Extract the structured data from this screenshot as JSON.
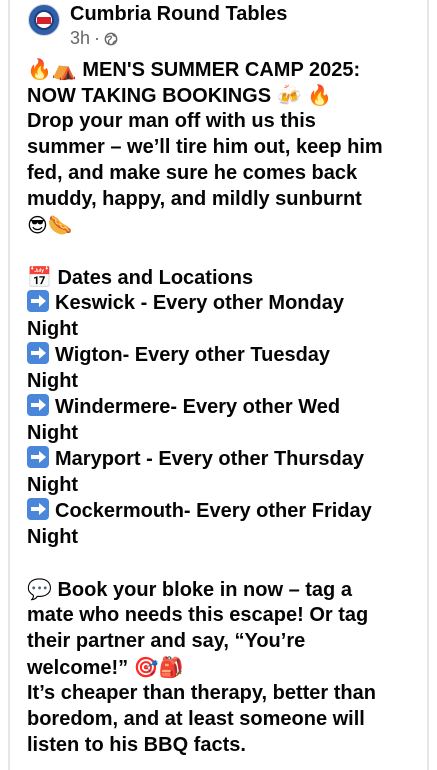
{
  "post": {
    "page_name": "Cumbria Round Tables",
    "time": "3h",
    "separator": "·",
    "line1": "MEN'S SUMMER CAMP 2025:",
    "line2": "NOW TAKING BOOKINGS",
    "line3": "Drop your man off with us this",
    "line4": "summer – we’ll tire him out, keep him",
    "line5": "fed, and make sure he comes back",
    "line6": "muddy, happy, and mildly sunburnt",
    "dates_heading": "Dates and Locations",
    "loc1a": "Keswick - Every other Monday",
    "loc1b": "Night",
    "loc2a": "Wigton- Every other Tuesday",
    "loc2b": "Night",
    "loc3a": "Windermere- Every other Wed",
    "loc3b": "Night",
    "loc4a": "Maryport - Every other Thursday",
    "loc4b": "Night",
    "loc5a": "Cockermouth- Every other Friday",
    "loc5b": "Night",
    "cta1": "Book your bloke in now – tag a",
    "cta2": "mate who needs this escape! Or tag",
    "cta3": "their partner and say, “You’re",
    "cta4": "welcome!”",
    "end1": "It’s cheaper than therapy, better than",
    "end2": "boredom, and at least someone will",
    "end3": "listen to his BBQ facts."
  },
  "emoji": {
    "fire": "🔥",
    "tent": "⛺",
    "beers": "🍻",
    "sunglasses": "😎",
    "hotdog": "🌭",
    "calendar": "📅",
    "speech": "💬",
    "target": "🎯",
    "backpack": "🎒"
  },
  "icons": {
    "globe": "globe-icon",
    "arrow": "right-arrow-icon"
  },
  "colors": {
    "text": "#050505",
    "meta": "#65676b",
    "arrow_box": "#4a86d9"
  }
}
